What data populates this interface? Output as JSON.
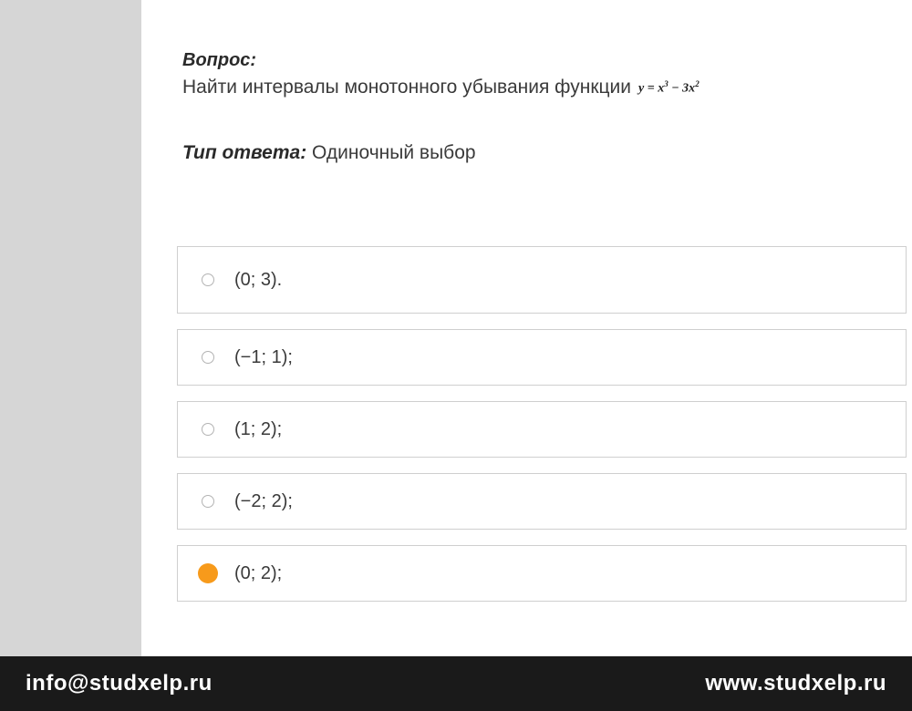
{
  "question": {
    "label": "Вопрос:",
    "text": "Найти интервалы монотонного убывания функции",
    "formula_y": "y = x",
    "formula_exp1": "3",
    "formula_minus": " − 3x",
    "formula_exp2": "2"
  },
  "answerType": {
    "label": "Тип ответа:",
    "value": "Одиночный выбор"
  },
  "options": [
    {
      "text": "(0; 3).",
      "selected": false
    },
    {
      "text": "(−1; 1);",
      "selected": false
    },
    {
      "text": "(1; 2);",
      "selected": false
    },
    {
      "text": "(−2; 2);",
      "selected": false
    },
    {
      "text": "(0; 2);",
      "selected": true
    }
  ],
  "footer": {
    "email": "info@studxelp.ru",
    "website": "www.studxelp.ru"
  }
}
